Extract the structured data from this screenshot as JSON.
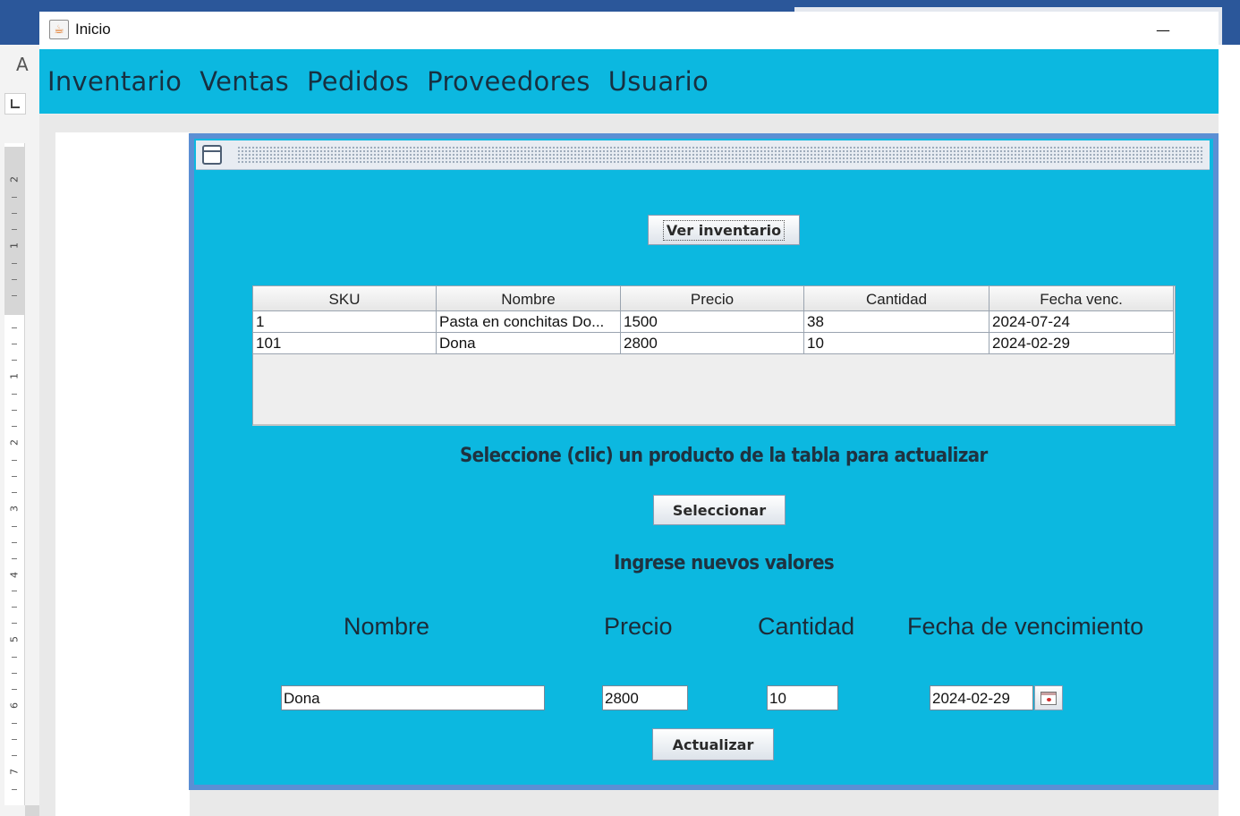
{
  "background": {
    "toolbar_letter": "A",
    "ruler_numbers": [
      "2",
      "1",
      "1",
      "2",
      "3",
      "4",
      "5",
      "6",
      "7"
    ]
  },
  "window": {
    "title": "Inicio",
    "minimize_symbol": "—"
  },
  "menu": {
    "items": [
      "Inventario",
      "Ventas",
      "Pedidos",
      "Proveedores",
      "Usuario"
    ]
  },
  "inventory_frame": {
    "view_button": "Ver inventario",
    "table": {
      "columns": [
        "SKU",
        "Nombre",
        "Precio",
        "Cantidad",
        "Fecha venc."
      ],
      "rows": [
        [
          "1",
          "Pasta en conchitas Do...",
          "1500",
          "38",
          "2024-07-24"
        ],
        [
          "101",
          "Dona",
          "2800",
          "10",
          "2024-02-29"
        ]
      ]
    },
    "select_instruction": "Seleccione (clic) un producto de la tabla para actualizar",
    "select_button": "Seleccionar",
    "new_values_heading": "Ingrese nuevos valores",
    "labels": {
      "name": "Nombre",
      "price": "Precio",
      "quantity": "Cantidad",
      "expiry": "Fecha de vencimiento"
    },
    "inputs": {
      "name": "Dona",
      "price": "2800",
      "quantity": "10",
      "expiry": "2024-02-29"
    },
    "update_button": "Actualizar"
  },
  "colors": {
    "accent": "#0cb8e0",
    "frame_border": "#5b8fd4",
    "text_dark": "#1f3240"
  }
}
